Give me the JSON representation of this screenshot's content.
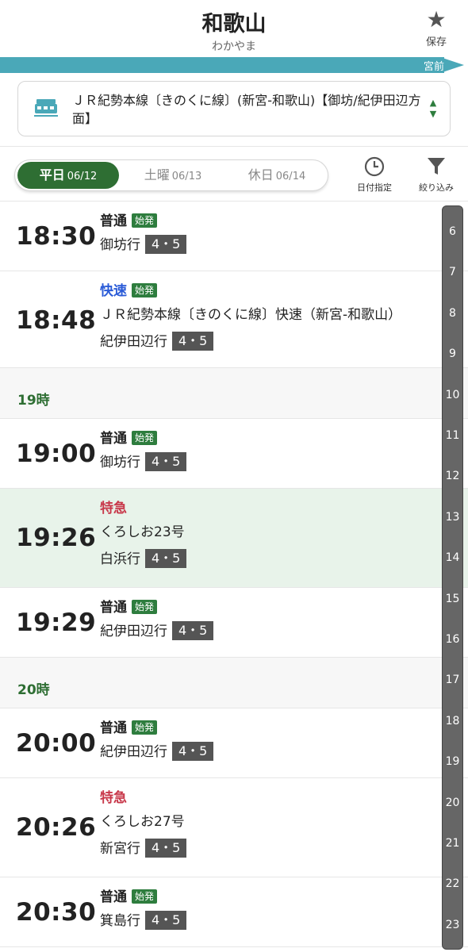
{
  "header": {
    "station_name": "和歌山",
    "station_kana": "わかやま",
    "save_label": "保存",
    "next_station": "宮前"
  },
  "line": {
    "name": "ＪＲ紀勢本線〔きのくに線〕(新宮-和歌山)【御坊/紀伊田辺方面】",
    "up_arrow": "▲",
    "down_arrow": "▼"
  },
  "day_tabs": [
    {
      "label": "平日",
      "date": "06/12",
      "active": true
    },
    {
      "label": "土曜",
      "date": "06/13",
      "active": false
    },
    {
      "label": "休日",
      "date": "06/14",
      "active": false
    }
  ],
  "tools": {
    "date_label": "日付指定",
    "filter_label": "絞り込み"
  },
  "hours": {
    "h19": "19時",
    "h20": "20時"
  },
  "departures": {
    "d1830": {
      "time": "18:30",
      "type": "普通",
      "badge": "始発",
      "dest": "御坊行",
      "platform": "4・5"
    },
    "d1848": {
      "time": "18:48",
      "type": "快速",
      "badge": "始発",
      "line_name": "ＪＲ紀勢本線〔きのくに線〕快速（新宮-和歌山）",
      "dest": "紀伊田辺行",
      "platform": "4・5"
    },
    "d1900": {
      "time": "19:00",
      "type": "普通",
      "badge": "始発",
      "dest": "御坊行",
      "platform": "4・5"
    },
    "d1926": {
      "time": "19:26",
      "type": "特急",
      "train_name": "くろしお23号",
      "dest": "白浜行",
      "platform": "4・5"
    },
    "d1929": {
      "time": "19:29",
      "type": "普通",
      "badge": "始発",
      "dest": "紀伊田辺行",
      "platform": "4・5"
    },
    "d2000": {
      "time": "20:00",
      "type": "普通",
      "badge": "始発",
      "dest": "紀伊田辺行",
      "platform": "4・5"
    },
    "d2026": {
      "time": "20:26",
      "type": "特急",
      "train_name": "くろしお27号",
      "dest": "新宮行",
      "platform": "4・5"
    },
    "d2030": {
      "time": "20:30",
      "type": "普通",
      "badge": "始発",
      "dest": "箕島行",
      "platform": "4・5"
    }
  },
  "hour_index": [
    "6",
    "7",
    "8",
    "9",
    "10",
    "11",
    "12",
    "13",
    "14",
    "15",
    "16",
    "17",
    "18",
    "19",
    "20",
    "21",
    "22",
    "23"
  ],
  "icons": {
    "save": "star-icon",
    "line": "train-icon",
    "date": "clock-icon",
    "filter": "filter-icon"
  },
  "colors": {
    "accent_green": "#2e6e33",
    "direction_bar": "#4aa8b8",
    "rapid_blue": "#2a5bd7",
    "limited_express_red": "#c8384a",
    "highlight_row": "#e8f3ea"
  }
}
